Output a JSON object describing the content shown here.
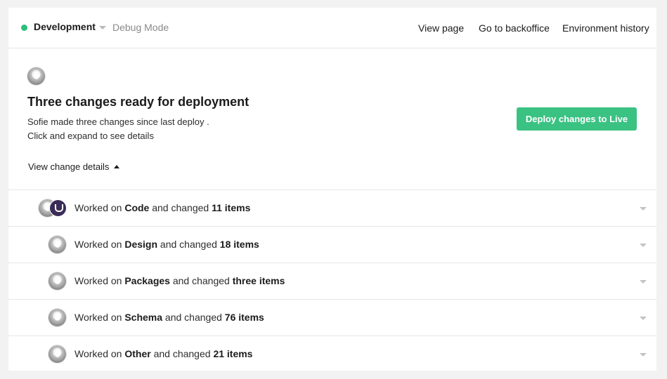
{
  "colors": {
    "env_dot": "#2bbf7a",
    "deploy_button": "#3ac283"
  },
  "header": {
    "environment": "Development",
    "mode": "Debug Mode",
    "nav": {
      "view_page": "View page",
      "backoffice": "Go to backoffice",
      "history": "Environment history"
    }
  },
  "summary": {
    "title": "Three changes ready for deployment",
    "line1": "Sofie made three changes since last deploy .",
    "line2": "Click and expand to see details",
    "toggle_label": "View change details",
    "deploy_label": "Deploy changes to Live"
  },
  "changes": [
    {
      "prefix": "Worked on ",
      "area": "Code",
      "middle": " and changed ",
      "count": "11 items"
    },
    {
      "prefix": "Worked on ",
      "area": "Design",
      "middle": " and changed ",
      "count": "18 items"
    },
    {
      "prefix": "Worked on ",
      "area": "Packages",
      "middle": " and changed ",
      "count": "three items"
    },
    {
      "prefix": "Worked on ",
      "area": "Schema",
      "middle": " and changed ",
      "count": "76 items"
    },
    {
      "prefix": "Worked on ",
      "area": "Other",
      "middle": " and changed ",
      "count": "21 items"
    }
  ]
}
